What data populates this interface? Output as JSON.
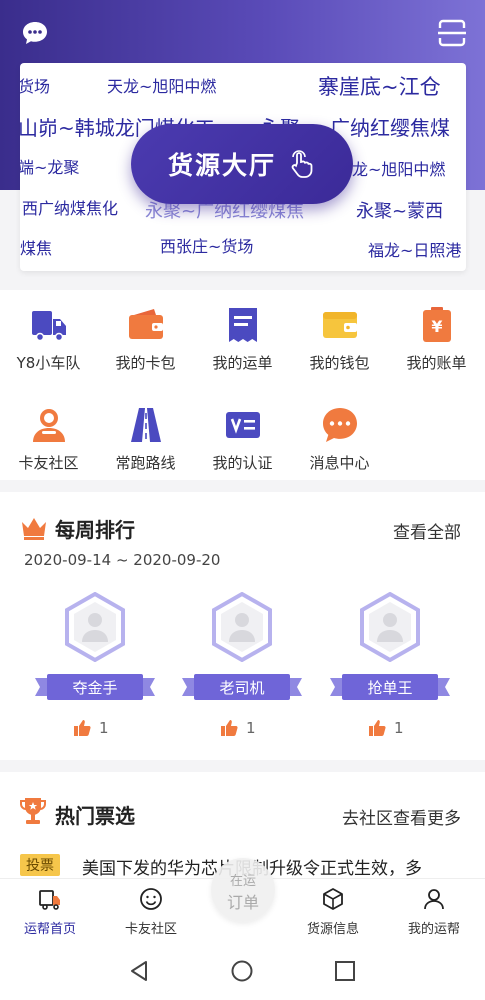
{
  "header": {
    "message_icon": "chat-bubble-icon",
    "scan_icon": "scan-icon",
    "accent_color": "#3a2d8c"
  },
  "board": {
    "routes": [
      "货场",
      "天龙~旭阳中燃",
      "寨崖底~江仓",
      "山峁~韩城龙门煤化工",
      "永聚",
      "广纳红缨焦煤",
      "端~龙聚",
      "龙~旭阳中燃",
      "西广纳煤焦化",
      "永聚~广纳红缨煤焦",
      "永聚~蒙西",
      "煤焦",
      "西张庄~货场",
      "福龙~日照港"
    ],
    "hall_button": "货源大厅"
  },
  "menu": {
    "items": [
      {
        "label": "Y8小车队",
        "icon": "truck-icon"
      },
      {
        "label": "我的卡包",
        "icon": "card-wallet-icon"
      },
      {
        "label": "我的运单",
        "icon": "waybill-icon"
      },
      {
        "label": "我的钱包",
        "icon": "wallet-icon"
      },
      {
        "label": "我的账单",
        "icon": "bill-icon"
      },
      {
        "label": "卡友社区",
        "icon": "community-icon"
      },
      {
        "label": "常跑路线",
        "icon": "road-icon"
      },
      {
        "label": "我的认证",
        "icon": "verify-icon"
      },
      {
        "label": "消息中心",
        "icon": "message-icon"
      }
    ]
  },
  "weekly_rank": {
    "title": "每周排行",
    "more": "查看全部",
    "date_range": "2020-09-14 ~ 2020-09-20",
    "items": [
      {
        "title": "夺金手",
        "likes": "1"
      },
      {
        "title": "老司机",
        "likes": "1"
      },
      {
        "title": "抢单王",
        "likes": "1"
      }
    ]
  },
  "hot_topics": {
    "title": "热门票选",
    "more": "去社区查看更多",
    "tag": "投票",
    "first_item": "美国下发的华为芯片限制升级令正式生效，多"
  },
  "tabbar": {
    "tabs": [
      {
        "label": "运帮首页",
        "icon": "home-truck-icon"
      },
      {
        "label": "卡友社区",
        "icon": "smile-icon"
      },
      {
        "label": "货源信息",
        "icon": "box-icon"
      },
      {
        "label": "我的运帮",
        "icon": "person-icon"
      }
    ],
    "center_top": "在运",
    "center_bottom": "订单"
  }
}
